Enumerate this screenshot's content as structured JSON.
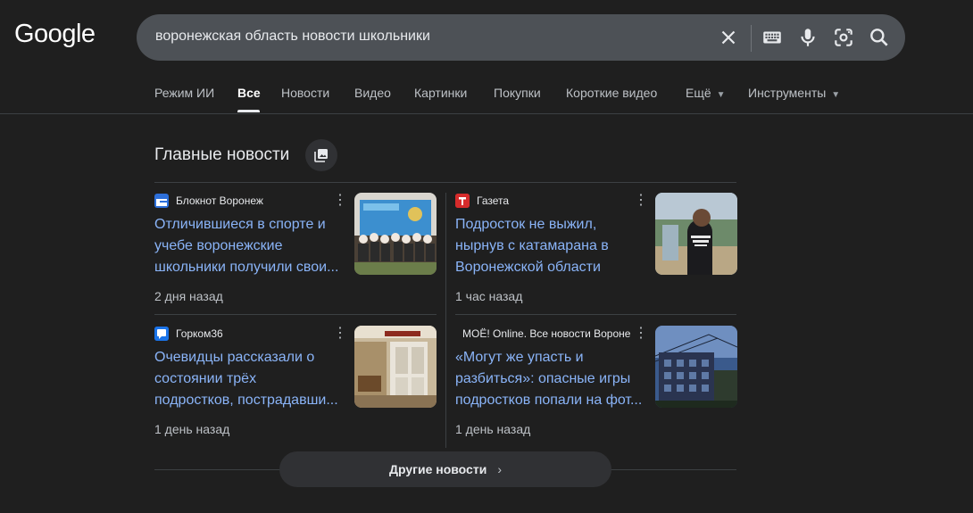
{
  "logo": "Google",
  "search": {
    "query": "воронежская область новости школьники"
  },
  "tabs": [
    {
      "label": "Режим ИИ"
    },
    {
      "label": "Все"
    },
    {
      "label": "Новости"
    },
    {
      "label": "Видео"
    },
    {
      "label": "Картинки"
    },
    {
      "label": "Покупки"
    },
    {
      "label": "Короткие видео"
    },
    {
      "label": "Ещё"
    },
    {
      "label": "Инструменты"
    }
  ],
  "section": {
    "title": "Главные новости"
  },
  "cards": [
    {
      "source": "Блокнот Воронеж",
      "lines": [
        "Отличившиеся в спорте и",
        "учебе воронежские",
        "школьники получили свои..."
      ],
      "time": "2 дня назад",
      "icon_color": "#2d6fd9"
    },
    {
      "source": "Газета",
      "lines": [
        "Подросток не выжил,",
        "нырнув с катамарана в",
        "Воронежской области"
      ],
      "time": "1 час назад",
      "icon_color": "#d62b2b"
    },
    {
      "source": "Горком36",
      "lines": [
        "Очевидцы рассказали о",
        "состоянии трёх",
        "подростков, пострадавши..."
      ],
      "time": "1 день назад",
      "icon_color": "#1a73e8"
    },
    {
      "source": "МОЁ! Online. Все новости Вороне",
      "lines": [
        "«Могут же упасть и",
        "разбиться»: опасные игры",
        "подростков попали на фот..."
      ],
      "time": "1 день назад",
      "icon_color": ""
    }
  ],
  "more_button": {
    "label": "Другие новости"
  },
  "colors": {
    "background": "#1f1f1f",
    "link": "#8ab4f8",
    "search_bg": "#4d5156"
  },
  "icons": [
    "close-icon",
    "keyboard-icon",
    "mic-icon",
    "lens-icon",
    "search-icon",
    "gallery-icon",
    "more-vert-icon",
    "chevron-right-icon"
  ]
}
